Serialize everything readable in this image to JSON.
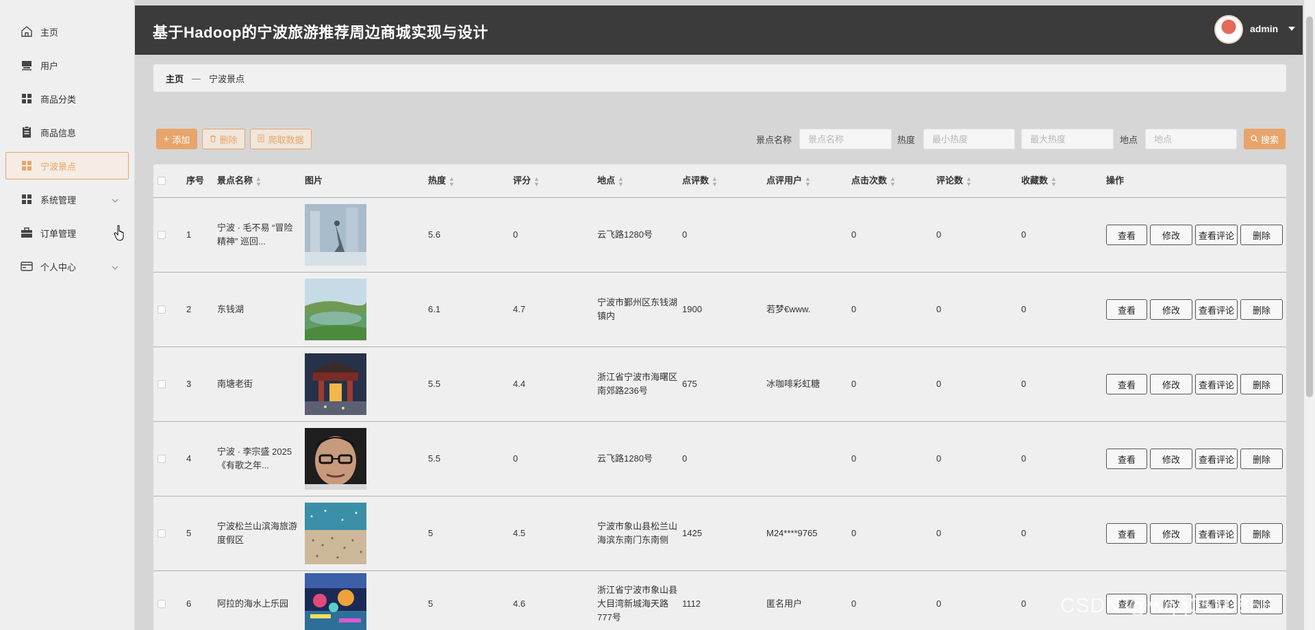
{
  "sidebar": {
    "items": [
      {
        "label": "主页",
        "icon": "home-icon"
      },
      {
        "label": "用户",
        "icon": "user-icon"
      },
      {
        "label": "商品分类",
        "icon": "grid-icon"
      },
      {
        "label": "商品信息",
        "icon": "clipboard-icon"
      },
      {
        "label": "宁波景点",
        "icon": "grid-icon",
        "active": true
      },
      {
        "label": "系统管理",
        "icon": "grid-icon",
        "expandable": true
      },
      {
        "label": "订单管理",
        "icon": "briefcase-icon"
      },
      {
        "label": "个人中心",
        "icon": "card-icon",
        "expandable": true
      }
    ]
  },
  "header": {
    "title": "基于Hadoop的宁波旅游推荐周边商城实现与设计",
    "user": "admin"
  },
  "breadcrumb": {
    "home": "主页",
    "sep": "—",
    "current": "宁波景点"
  },
  "toolbar": {
    "add_label": "添加",
    "delete_label": "删除",
    "crawl_label": "爬取数据",
    "search_label": "搜索",
    "filters": {
      "name_label": "景点名称",
      "name_placeholder": "景点名称",
      "heat_label": "热度",
      "heat_min_placeholder": "最小热度",
      "heat_max_placeholder": "最大热度",
      "location_label": "地点",
      "location_placeholder": "地点"
    }
  },
  "table": {
    "headers": {
      "index": "序号",
      "name": "景点名称",
      "image": "图片",
      "heat": "热度",
      "rating": "评分",
      "location": "地点",
      "review_count": "点评数",
      "review_user": "点评用户",
      "clicks": "点击次数",
      "comments": "评论数",
      "favorites": "收藏数",
      "actions": "操作"
    },
    "action_labels": {
      "view": "查看",
      "edit": "修改",
      "view_comments": "查看评论",
      "delete": "删除"
    },
    "rows": [
      {
        "index": "1",
        "name": "宁波 · 毛不易 “冒险精神” 巡回...",
        "image": "misty-city-figure",
        "heat": "5.6",
        "rating": "0",
        "location": "云飞路1280号",
        "review_count": "0",
        "review_user": "",
        "clicks": "0",
        "comments": "0",
        "favorites": "0"
      },
      {
        "index": "2",
        "name": "东钱湖",
        "image": "lake-aerial",
        "heat": "6.1",
        "rating": "4.7",
        "location": "宁波市鄞州区东钱湖镇内",
        "review_count": "1900",
        "review_user": "若梦€www.",
        "clicks": "0",
        "comments": "0",
        "favorites": "0"
      },
      {
        "index": "3",
        "name": "南塘老街",
        "image": "old-street-gate",
        "heat": "5.5",
        "rating": "4.4",
        "location": "浙江省宁波市海曙区南郊路236号",
        "review_count": "675",
        "review_user": "冰咖啡彩虹糖",
        "clicks": "0",
        "comments": "0",
        "favorites": "0"
      },
      {
        "index": "4",
        "name": "宁波 · 李宗盛 2025《有歌之年...",
        "image": "portrait-glasses",
        "heat": "5.5",
        "rating": "0",
        "location": "云飞路1280号",
        "review_count": "0",
        "review_user": "",
        "clicks": "0",
        "comments": "0",
        "favorites": "0"
      },
      {
        "index": "5",
        "name": "宁波松兰山滨海旅游度假区",
        "image": "beach-crowd",
        "heat": "5",
        "rating": "4.5",
        "location": "宁波市象山县松兰山海滨东南门东南侧",
        "review_count": "1425",
        "review_user": "M24****9765",
        "clicks": "0",
        "comments": "0",
        "favorites": "0"
      },
      {
        "index": "6",
        "name": "阿拉的海水上乐园",
        "image": "water-park-night",
        "heat": "5",
        "rating": "4.6",
        "location": "浙江省宁波市象山县大目湾新城海天路777号",
        "review_count": "1112",
        "review_user": "匿名用户",
        "clicks": "0",
        "comments": "0",
        "favorites": "0"
      }
    ]
  },
  "watermark": "CSDN @wqq0510855",
  "colors": {
    "accent": "#e8a46a",
    "header_bg": "#3a3b3a"
  }
}
